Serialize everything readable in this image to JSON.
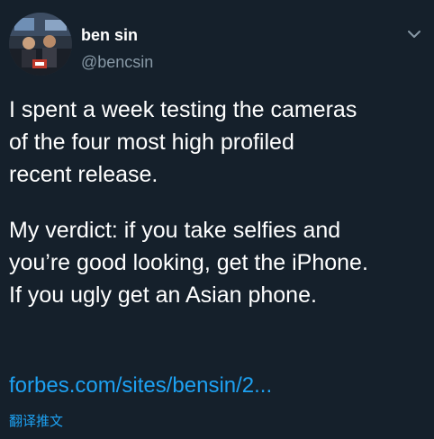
{
  "tweet": {
    "author": {
      "display_name": "ben sin",
      "handle": "@bencsin",
      "avatar_icon": "profile-photo-avatar"
    },
    "menu_icon": "chevron-down-icon",
    "paragraphs": [
      {
        "lines": [
          "I spent a week testing the cameras",
          "of the four most high profiled",
          "recent release."
        ]
      },
      {
        "lines": [
          "My verdict: if you take selfies and",
          "you’re good looking, get the iPhone.",
          "If you ugly get an Asian phone."
        ]
      }
    ],
    "link_text": "forbes.com/sites/bensin/2...",
    "translate_label": "翻译推文"
  },
  "colors": {
    "background": "#15202b",
    "text": "#ffffff",
    "secondary_text": "#8899a6",
    "link": "#1da1f2"
  }
}
